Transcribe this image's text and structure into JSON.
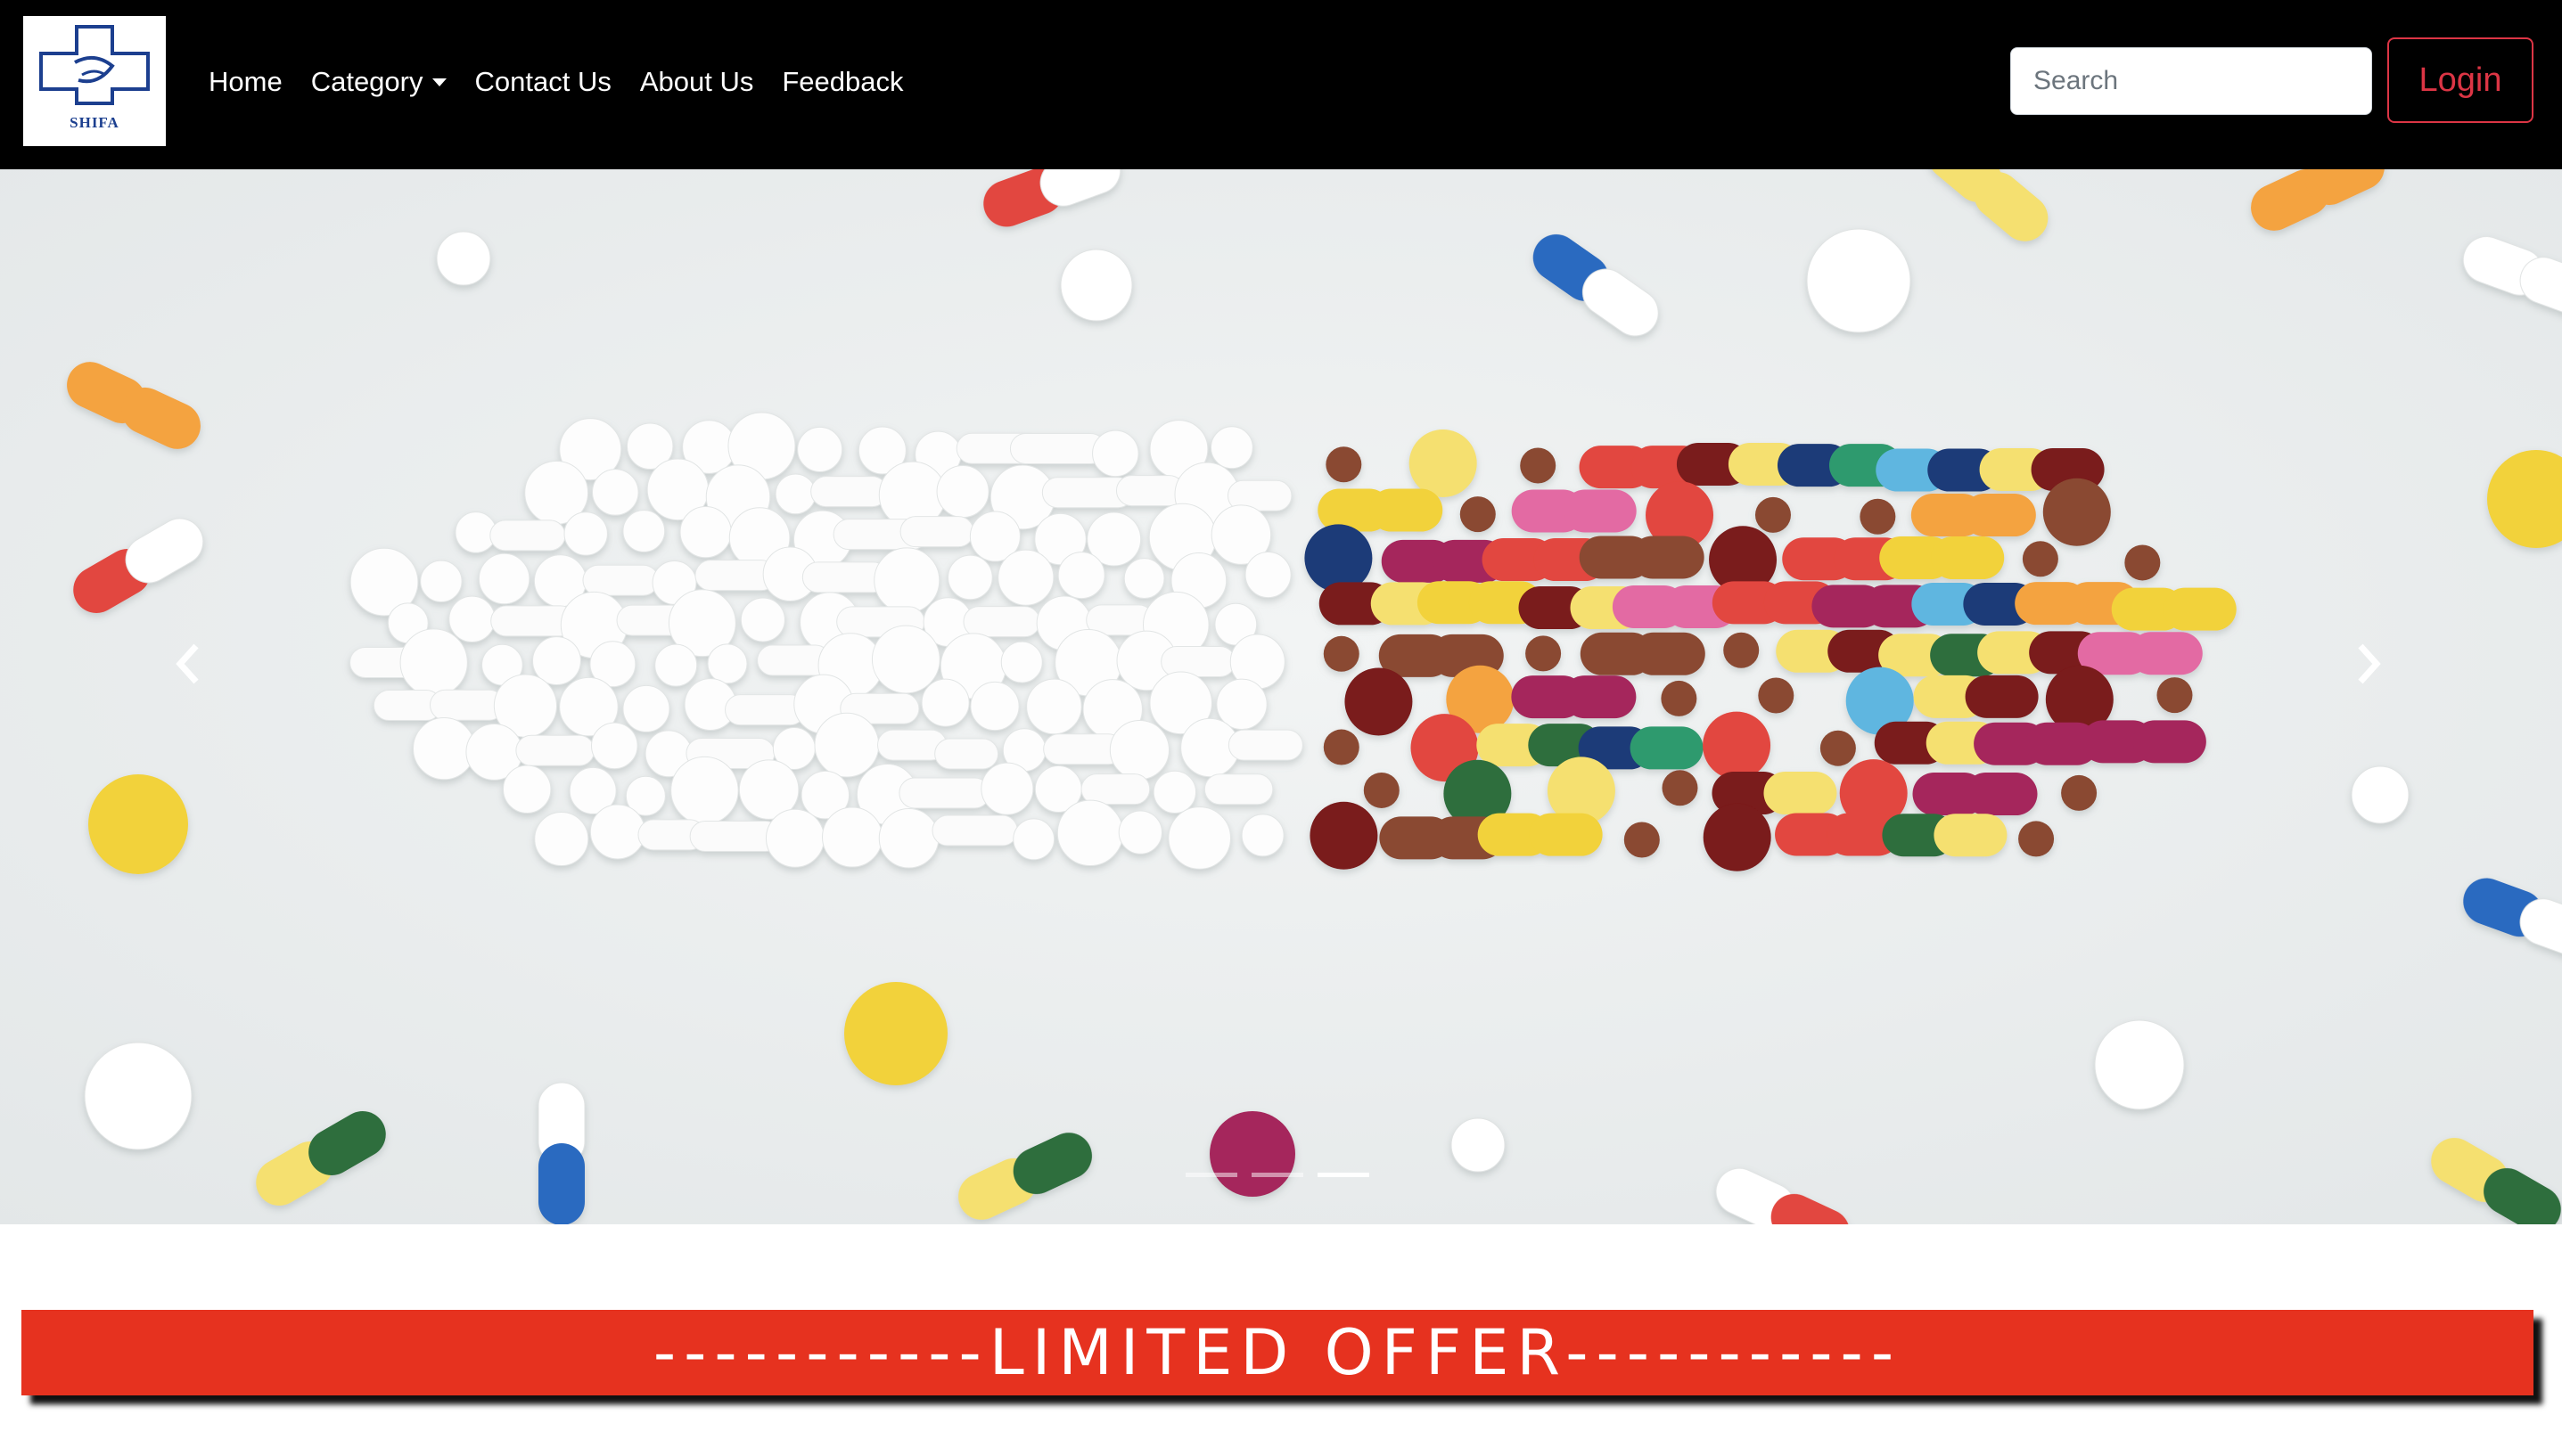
{
  "brand": {
    "logo_text": "SHIFA",
    "accent": "#1c3f8f"
  },
  "nav": {
    "items": [
      {
        "label": "Home"
      },
      {
        "label": "Category",
        "has_dropdown": true
      },
      {
        "label": "Contact Us"
      },
      {
        "label": "About Us"
      },
      {
        "label": "Feedback"
      }
    ]
  },
  "search": {
    "placeholder": "Search",
    "value": ""
  },
  "login": {
    "label": "Login",
    "color": "#dc3545"
  },
  "carousel": {
    "slides": 3,
    "active_index": 2,
    "prev_icon": "chevron-left-icon",
    "next_icon": "chevron-right-icon"
  },
  "offer": {
    "text": "-----------LIMITED OFFER-----------",
    "background": "#e6321f"
  }
}
